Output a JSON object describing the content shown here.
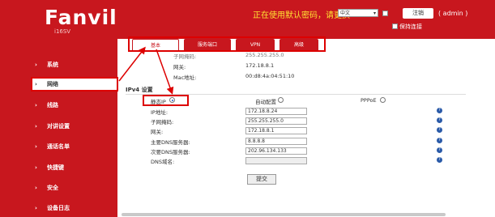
{
  "header": {
    "logo": "Fanvil",
    "model": "i16SV",
    "warning": "正在使用默认密码，请更换",
    "language": "中文",
    "logout_label": "注销",
    "user": "( admin )",
    "keep_login": "保持连接"
  },
  "sidebar": {
    "items": [
      {
        "label": "系统"
      },
      {
        "label": "网络"
      },
      {
        "label": "线路"
      },
      {
        "label": "对讲设置"
      },
      {
        "label": "通话名单"
      },
      {
        "label": "快捷键"
      },
      {
        "label": "安全"
      },
      {
        "label": "设备日志"
      }
    ]
  },
  "tabs": [
    {
      "label": "基本"
    },
    {
      "label": "服务端口"
    },
    {
      "label": "VPN"
    },
    {
      "label": "高级"
    }
  ],
  "status": {
    "subnet_label": "子网掩码:",
    "subnet_value": "255.255.255.0",
    "gateway_label": "网关:",
    "gateway_value": "172.18.8.1",
    "mac_label": "Mac地址:",
    "mac_value": "00:d8:4a:04:51:10"
  },
  "ipv4": {
    "title": "IPv4 设置",
    "mode_static": "静态IP",
    "mode_dhcp": "自动配置",
    "mode_pppoe": "PPPoE",
    "fields": [
      {
        "label": "IP地址:",
        "value": "172.18.8.24"
      },
      {
        "label": "子网掩码:",
        "value": "255.255.255.0"
      },
      {
        "label": "网关:",
        "value": "172.18.8.1"
      },
      {
        "label": "主要DNS服务器:",
        "value": "8.8.8.8"
      },
      {
        "label": "次要DNS服务器:",
        "value": "202.96.134.133"
      },
      {
        "label": "DNS域名:",
        "value": ""
      }
    ],
    "submit_label": "提交"
  },
  "colors": {
    "brand_red": "#c8171e",
    "warning_yellow": "#ffe033",
    "help_blue": "#2a5aa8"
  }
}
